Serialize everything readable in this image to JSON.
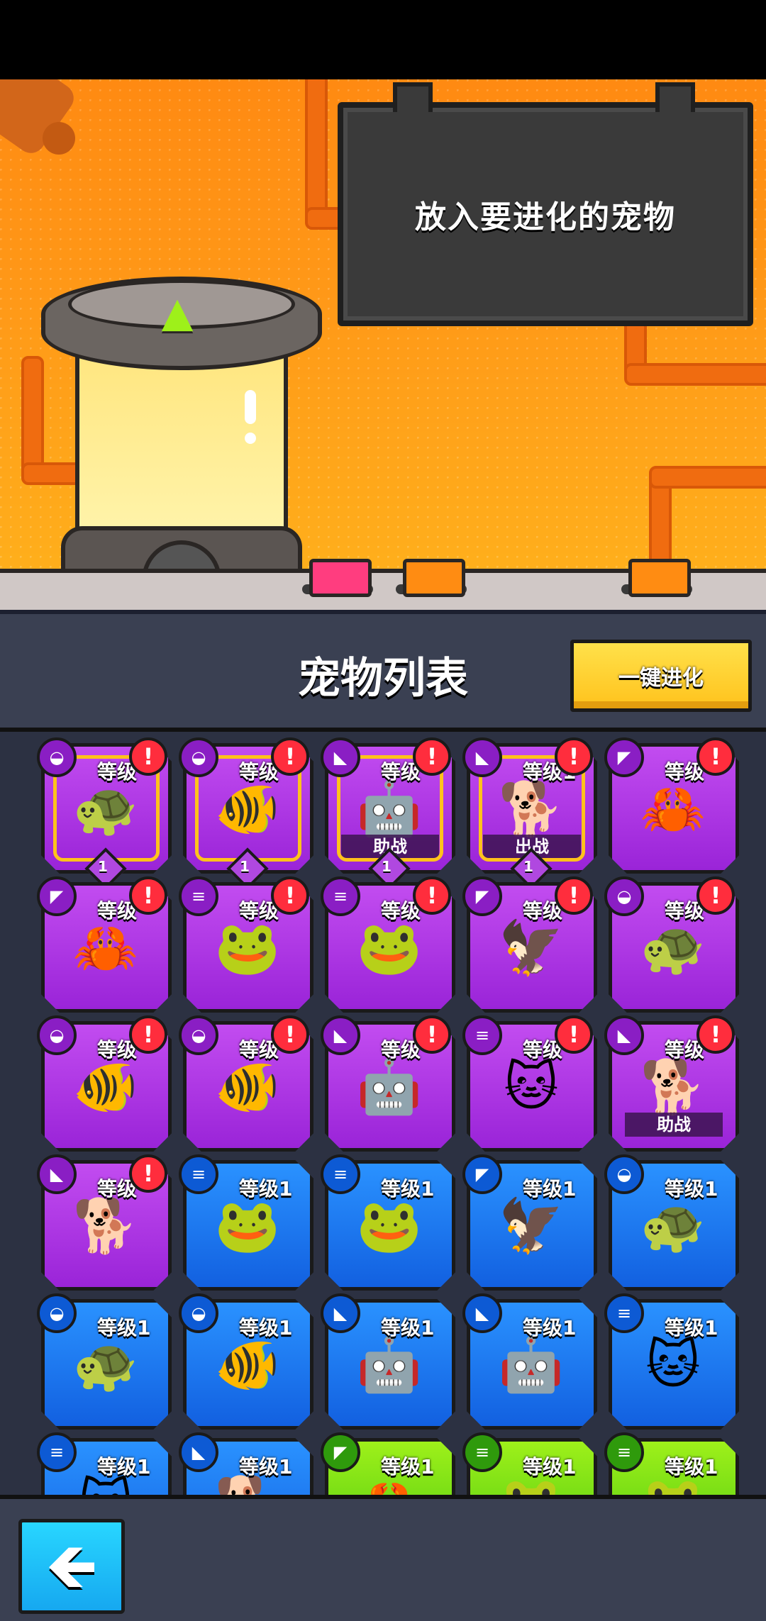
{
  "scene": {
    "board_text": "放入要进化的宠物",
    "up_arrow_icon": "up-arrow-icon",
    "buttons": [
      {
        "name": "pink-floor-button",
        "color": "#ff3d7f"
      },
      {
        "name": "orange-floor-button-1",
        "color": "#ff8c12"
      },
      {
        "name": "orange-floor-button-2",
        "color": "#ff8c12"
      }
    ]
  },
  "panel": {
    "title": "宠物列表",
    "evolve_all_label": "一键进化"
  },
  "pets": [
    {
      "pet": "turtle",
      "icon": "🐢",
      "rarity": "purple",
      "type": "turtle-icon",
      "type_glyph": "◒",
      "level": "等级",
      "alert": true,
      "selected": true,
      "gem": "1",
      "tag": ""
    },
    {
      "pet": "goldfish",
      "icon": "🐠",
      "rarity": "purple",
      "type": "turtle-icon",
      "type_glyph": "◒",
      "level": "等级",
      "alert": true,
      "selected": true,
      "gem": "1",
      "tag": ""
    },
    {
      "pet": "robot",
      "icon": "🤖",
      "rarity": "purple",
      "type": "dog-icon",
      "type_glyph": "◣",
      "level": "等级",
      "alert": true,
      "selected": true,
      "gem": "1",
      "tag": "助战"
    },
    {
      "pet": "dog",
      "icon": "🐕",
      "rarity": "purple",
      "type": "dog-icon",
      "type_glyph": "◣",
      "level": "等级1",
      "alert": true,
      "selected": true,
      "gem": "1",
      "tag": "出战"
    },
    {
      "pet": "crab",
      "icon": "🦀",
      "rarity": "purple",
      "type": "eagle-icon",
      "type_glyph": "◤",
      "level": "等级",
      "alert": true,
      "selected": false,
      "gem": "",
      "tag": ""
    },
    {
      "pet": "crab",
      "icon": "🦀",
      "rarity": "purple",
      "type": "eagle-icon",
      "type_glyph": "◤",
      "level": "等级",
      "alert": true,
      "selected": false,
      "gem": "",
      "tag": ""
    },
    {
      "pet": "frog",
      "icon": "🐸",
      "rarity": "purple",
      "type": "coins-icon",
      "type_glyph": "≡",
      "level": "等级",
      "alert": true,
      "selected": false,
      "gem": "",
      "tag": ""
    },
    {
      "pet": "frog",
      "icon": "🐸",
      "rarity": "purple",
      "type": "coins-icon",
      "type_glyph": "≡",
      "level": "等级",
      "alert": true,
      "selected": false,
      "gem": "",
      "tag": ""
    },
    {
      "pet": "eagle",
      "icon": "🦅",
      "rarity": "purple",
      "type": "eagle-icon",
      "type_glyph": "◤",
      "level": "等级",
      "alert": true,
      "selected": false,
      "gem": "",
      "tag": ""
    },
    {
      "pet": "turtle",
      "icon": "🐢",
      "rarity": "purple",
      "type": "turtle-icon",
      "type_glyph": "◒",
      "level": "等级",
      "alert": true,
      "selected": false,
      "gem": "",
      "tag": ""
    },
    {
      "pet": "goldfish",
      "icon": "🐠",
      "rarity": "purple",
      "type": "turtle-icon",
      "type_glyph": "◒",
      "level": "等级",
      "alert": true,
      "selected": false,
      "gem": "",
      "tag": ""
    },
    {
      "pet": "goldfish",
      "icon": "🐠",
      "rarity": "purple",
      "type": "turtle-icon",
      "type_glyph": "◒",
      "level": "等级",
      "alert": true,
      "selected": false,
      "gem": "",
      "tag": ""
    },
    {
      "pet": "robot",
      "icon": "🤖",
      "rarity": "purple",
      "type": "dog-icon",
      "type_glyph": "◣",
      "level": "等级",
      "alert": true,
      "selected": false,
      "gem": "",
      "tag": ""
    },
    {
      "pet": "cat",
      "icon": "🐱",
      "rarity": "purple",
      "type": "coins-icon",
      "type_glyph": "≡",
      "level": "等级",
      "alert": true,
      "selected": false,
      "gem": "",
      "tag": ""
    },
    {
      "pet": "dog",
      "icon": "🐕",
      "rarity": "purple",
      "type": "dog-icon",
      "type_glyph": "◣",
      "level": "等级",
      "alert": true,
      "selected": false,
      "gem": "",
      "tag": "助战"
    },
    {
      "pet": "dog",
      "icon": "🐕",
      "rarity": "purple",
      "type": "dog-icon",
      "type_glyph": "◣",
      "level": "等级",
      "alert": true,
      "selected": false,
      "gem": "",
      "tag": ""
    },
    {
      "pet": "frog",
      "icon": "🐸",
      "rarity": "blue",
      "type": "coins-icon",
      "type_glyph": "≡",
      "level": "等级1",
      "alert": false,
      "selected": false,
      "gem": "",
      "tag": ""
    },
    {
      "pet": "frog",
      "icon": "🐸",
      "rarity": "blue",
      "type": "coins-icon",
      "type_glyph": "≡",
      "level": "等级1",
      "alert": false,
      "selected": false,
      "gem": "",
      "tag": ""
    },
    {
      "pet": "eagle",
      "icon": "🦅",
      "rarity": "blue",
      "type": "eagle-icon",
      "type_glyph": "◤",
      "level": "等级1",
      "alert": false,
      "selected": false,
      "gem": "",
      "tag": ""
    },
    {
      "pet": "turtle",
      "icon": "🐢",
      "rarity": "blue",
      "type": "turtle-icon",
      "type_glyph": "◒",
      "level": "等级1",
      "alert": false,
      "selected": false,
      "gem": "",
      "tag": ""
    },
    {
      "pet": "turtle",
      "icon": "🐢",
      "rarity": "blue",
      "type": "turtle-icon",
      "type_glyph": "◒",
      "level": "等级1",
      "alert": false,
      "selected": false,
      "gem": "",
      "tag": ""
    },
    {
      "pet": "goldfish",
      "icon": "🐠",
      "rarity": "blue",
      "type": "turtle-icon",
      "type_glyph": "◒",
      "level": "等级1",
      "alert": false,
      "selected": false,
      "gem": "",
      "tag": ""
    },
    {
      "pet": "robot",
      "icon": "🤖",
      "rarity": "blue",
      "type": "dog-icon",
      "type_glyph": "◣",
      "level": "等级1",
      "alert": false,
      "selected": false,
      "gem": "",
      "tag": ""
    },
    {
      "pet": "robot",
      "icon": "🤖",
      "rarity": "blue",
      "type": "dog-icon",
      "type_glyph": "◣",
      "level": "等级1",
      "alert": false,
      "selected": false,
      "gem": "",
      "tag": ""
    },
    {
      "pet": "cat",
      "icon": "🐱",
      "rarity": "blue",
      "type": "coins-icon",
      "type_glyph": "≡",
      "level": "等级1",
      "alert": false,
      "selected": false,
      "gem": "",
      "tag": ""
    },
    {
      "pet": "cat",
      "icon": "🐱",
      "rarity": "blue",
      "type": "coins-icon",
      "type_glyph": "≡",
      "level": "等级1",
      "alert": false,
      "selected": false,
      "gem": "",
      "tag": ""
    },
    {
      "pet": "dog",
      "icon": "🐕",
      "rarity": "blue",
      "type": "dog-icon",
      "type_glyph": "◣",
      "level": "等级1",
      "alert": false,
      "selected": false,
      "gem": "",
      "tag": ""
    },
    {
      "pet": "crab",
      "icon": "🦀",
      "rarity": "green",
      "type": "eagle-icon",
      "type_glyph": "◤",
      "level": "等级1",
      "alert": false,
      "selected": false,
      "gem": "",
      "tag": ""
    },
    {
      "pet": "frog",
      "icon": "🐸",
      "rarity": "green",
      "type": "coins-icon",
      "type_glyph": "≡",
      "level": "等级1",
      "alert": false,
      "selected": false,
      "gem": "",
      "tag": ""
    },
    {
      "pet": "frog",
      "icon": "🐸",
      "rarity": "green",
      "type": "coins-icon",
      "type_glyph": "≡",
      "level": "等级1",
      "alert": false,
      "selected": false,
      "gem": "",
      "tag": ""
    }
  ],
  "footer": {
    "back_glyph": "🡸"
  }
}
